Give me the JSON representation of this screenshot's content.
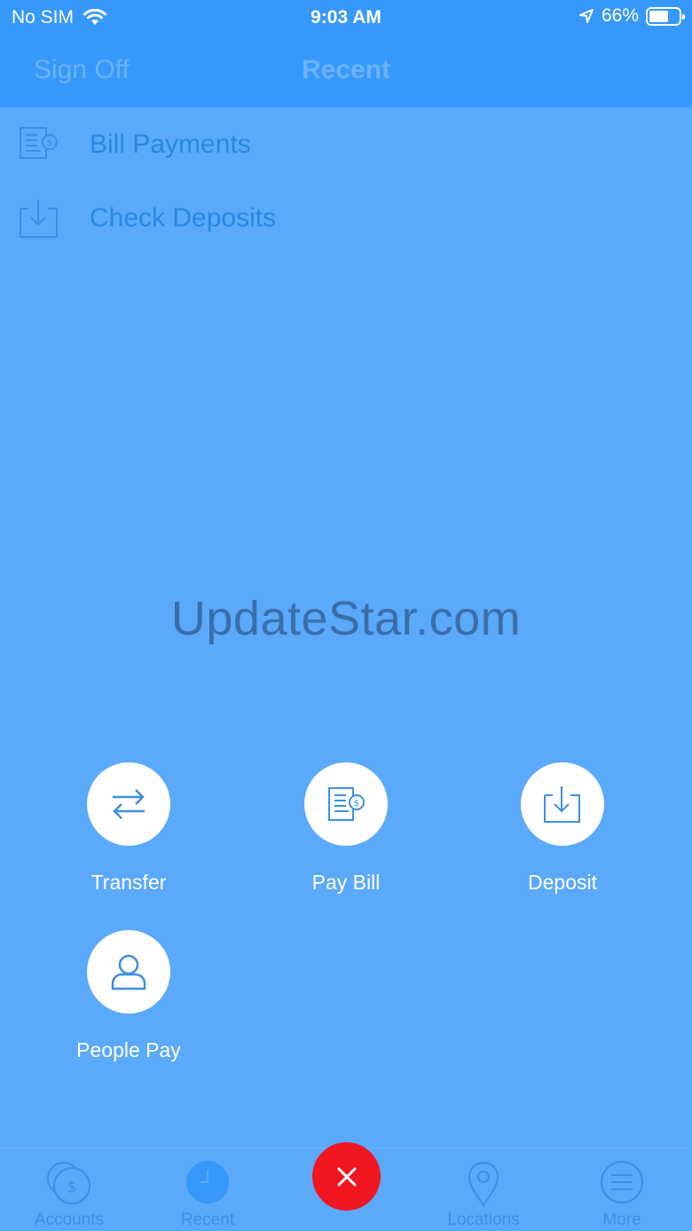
{
  "status_bar": {
    "carrier": "No SIM",
    "time": "9:03 AM",
    "battery_percent": "66%",
    "battery_level": 0.66
  },
  "nav": {
    "sign_off_label": "Sign Off",
    "title": "Recent"
  },
  "recent": {
    "items": [
      {
        "label": "Bill Payments",
        "icon": "bill-icon"
      },
      {
        "label": "Check Deposits",
        "icon": "deposit-icon"
      }
    ]
  },
  "watermark": "UpdateStar.com",
  "actions": [
    {
      "label": "Transfer",
      "icon": "transfer-arrows-icon"
    },
    {
      "label": "Pay Bill",
      "icon": "bill-icon"
    },
    {
      "label": "Deposit",
      "icon": "deposit-icon"
    },
    {
      "label": "People Pay",
      "icon": "person-icon"
    }
  ],
  "tabs": [
    {
      "label": "Accounts",
      "icon": "coins-icon"
    },
    {
      "label": "Recent",
      "icon": "clock-icon",
      "selected": true
    },
    {
      "label": "Locations",
      "icon": "map-pin-icon"
    },
    {
      "label": "More",
      "icon": "menu-icon"
    }
  ],
  "colors": {
    "overlay": "#5aa9fb",
    "header": "#3798fb",
    "close_button": "#f01620",
    "icon_blue": "#3d8fe3"
  }
}
